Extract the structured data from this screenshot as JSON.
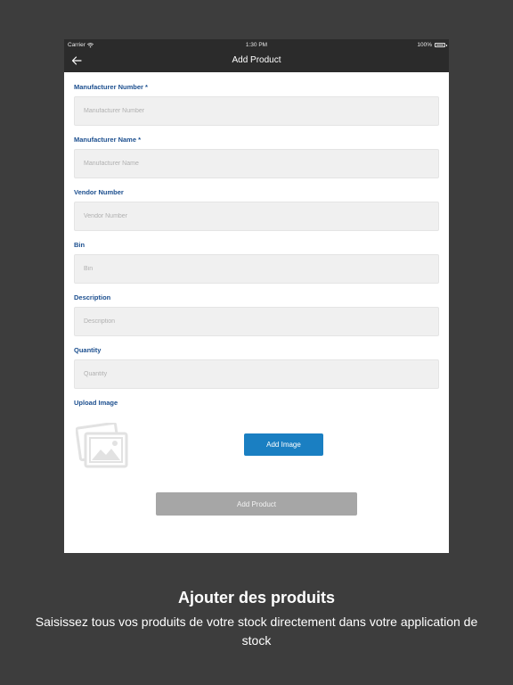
{
  "status_bar": {
    "carrier": "Carrier",
    "time": "1:30 PM",
    "battery": "100%"
  },
  "nav": {
    "title": "Add Product",
    "back_icon": "arrow-left-icon"
  },
  "form": {
    "fields": [
      {
        "label": "Manufacturer Number *",
        "placeholder": "Manufacturer Number",
        "value": ""
      },
      {
        "label": "Manufacturer Name *",
        "placeholder": "Manufacturer Name",
        "value": ""
      },
      {
        "label": "Vendor Number",
        "placeholder": "Vendor Number",
        "value": ""
      },
      {
        "label": "Bin",
        "placeholder": "Bin",
        "value": ""
      },
      {
        "label": "Description",
        "placeholder": "Description",
        "value": ""
      },
      {
        "label": "Quantity",
        "placeholder": "Quantity",
        "value": ""
      }
    ],
    "upload_label": "Upload Image",
    "image_placeholder_icon": "image-placeholder-icon",
    "add_image_label": "Add Image",
    "submit_label": "Add Product"
  },
  "caption": {
    "title": "Ajouter des produits",
    "text": "Saisissez tous vos produits de votre stock directement dans votre application de stock"
  },
  "colors": {
    "background": "#3d3d3d",
    "nav_bar": "#2b2b2b",
    "label": "#1c4f8f",
    "primary_button": "#1a7fc2",
    "disabled_button": "#a6a6a6"
  }
}
